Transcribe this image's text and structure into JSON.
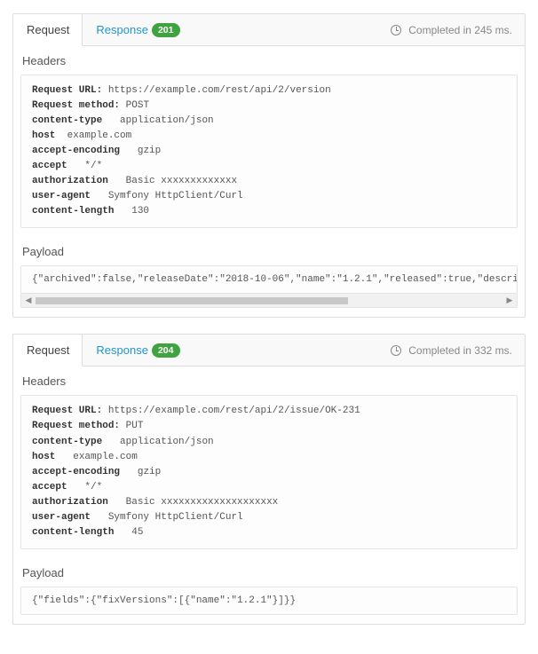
{
  "panel1": {
    "tabs": {
      "request": "Request",
      "response": "Response",
      "status_code": "201"
    },
    "timing_text": "Completed in 245 ms.",
    "headers_title": "Headers",
    "headers": {
      "url_label": "Request URL:",
      "url_value": "https://example.com/rest/api/2/version",
      "method_label": "Request method:",
      "method_value": "POST",
      "ct_label": "content-type",
      "ct_value": "application/json",
      "host_label": "host",
      "host_value": "example.com",
      "ae_label": "accept-encoding",
      "ae_value": "gzip",
      "accept_label": "accept",
      "accept_value": "*/*",
      "auth_label": "authorization",
      "auth_value": "Basic xxxxxxxxxxxxx",
      "ua_label": "user-agent",
      "ua_value": "Symfony HttpClient/Curl",
      "cl_label": "content-length",
      "cl_value": "130"
    },
    "payload_title": "Payload",
    "payload": "{\"archived\":false,\"releaseDate\":\"2018-10-06\",\"name\":\"1.2.1\",\"released\":true,\"description\":\"P"
  },
  "panel2": {
    "tabs": {
      "request": "Request",
      "response": "Response",
      "status_code": "204"
    },
    "timing_text": "Completed in 332 ms.",
    "headers_title": "Headers",
    "headers": {
      "url_label": "Request URL:",
      "url_value": "https://example.com/rest/api/2/issue/OK-231",
      "method_label": "Request method:",
      "method_value": "PUT",
      "ct_label": "content-type",
      "ct_value": "application/json",
      "host_label": "host",
      "host_value": "example.com",
      "ae_label": "accept-encoding",
      "ae_value": "gzip",
      "accept_label": "accept",
      "accept_value": "*/*",
      "auth_label": "authorization",
      "auth_value": "Basic xxxxxxxxxxxxxxxxxxxx",
      "ua_label": "user-agent",
      "ua_value": "Symfony HttpClient/Curl",
      "cl_label": "content-length",
      "cl_value": "45"
    },
    "payload_title": "Payload",
    "payload": "{\"fields\":{\"fixVersions\":[{\"name\":\"1.2.1\"}]}}"
  }
}
